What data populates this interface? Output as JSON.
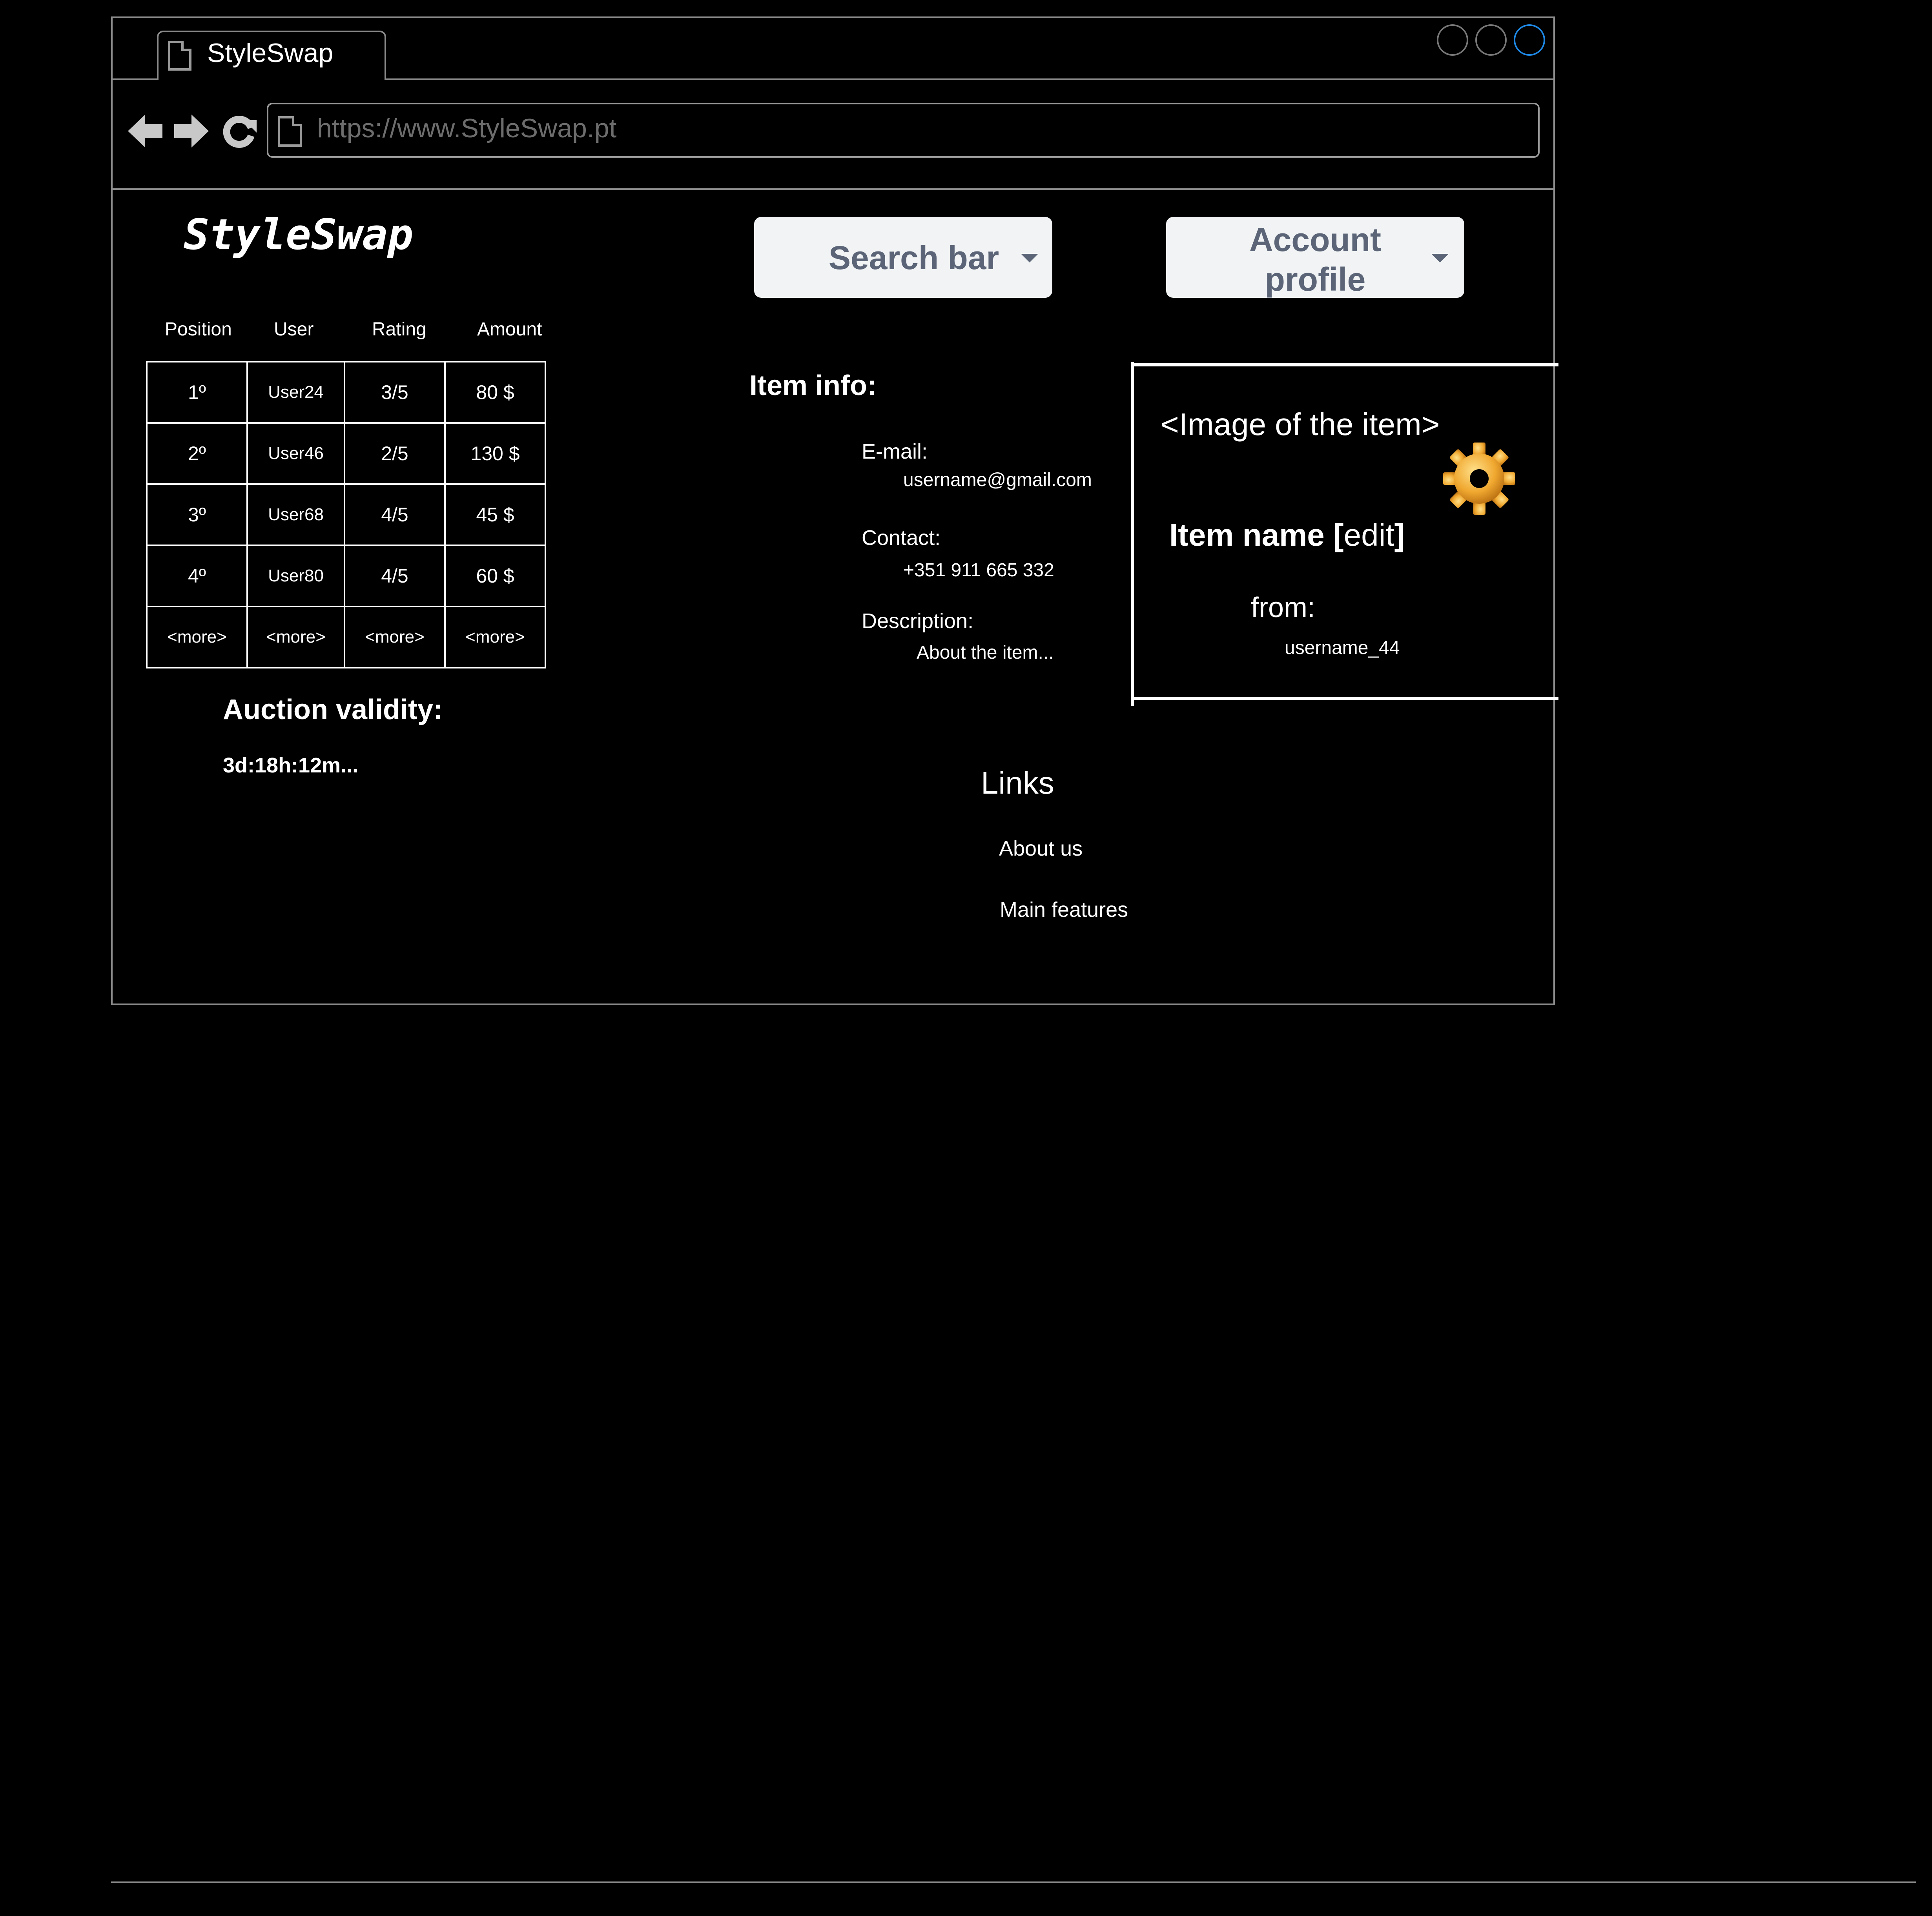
{
  "browser": {
    "tab_title": "StyleSwap",
    "url": "https://www.StyleSwap.pt",
    "icons": [
      "back-arrow-icon",
      "forward-arrow-icon",
      "reload-icon",
      "page-icon"
    ]
  },
  "header": {
    "logo": "StyleSwap",
    "search_label": "Search bar",
    "account_label_line1": "Account",
    "account_label_line2": "profile"
  },
  "ranking": {
    "headers": [
      "Position",
      "User",
      "Rating",
      "Amount"
    ],
    "rows": [
      [
        "1º",
        "User24",
        "3/5",
        "80 $"
      ],
      [
        "2º",
        "User46",
        "2/5",
        "130 $"
      ],
      [
        "3º",
        "User68",
        "4/5",
        "45 $"
      ],
      [
        "4º",
        "User80",
        "4/5",
        "60 $"
      ],
      [
        "<more>",
        "<more>",
        "<more>",
        "<more>"
      ]
    ]
  },
  "auction": {
    "title": "Auction validity:",
    "time_left": "3d:18h:12m..."
  },
  "item_info": {
    "title": "Item info:",
    "email_label": "E-mail:",
    "email_value": "username@gmail.com",
    "contact_label": "Contact:",
    "contact_value": "+351 911 665 332",
    "description_label": "Description:",
    "description_value": "About the item..."
  },
  "item_card": {
    "image_placeholder": "<Image of the item>",
    "name": "Item name [",
    "edit": "edit",
    "name_end": "]",
    "from_label": "from:",
    "owner": "username_44",
    "icon": "gear-icon"
  },
  "links": {
    "title": "Links",
    "about": "About us",
    "features": "Main features"
  },
  "colors": {
    "background": "#000000",
    "button_bg": "#f1f3f4",
    "button_text": "#5b6577",
    "active_window_button": "#1e88e5"
  }
}
